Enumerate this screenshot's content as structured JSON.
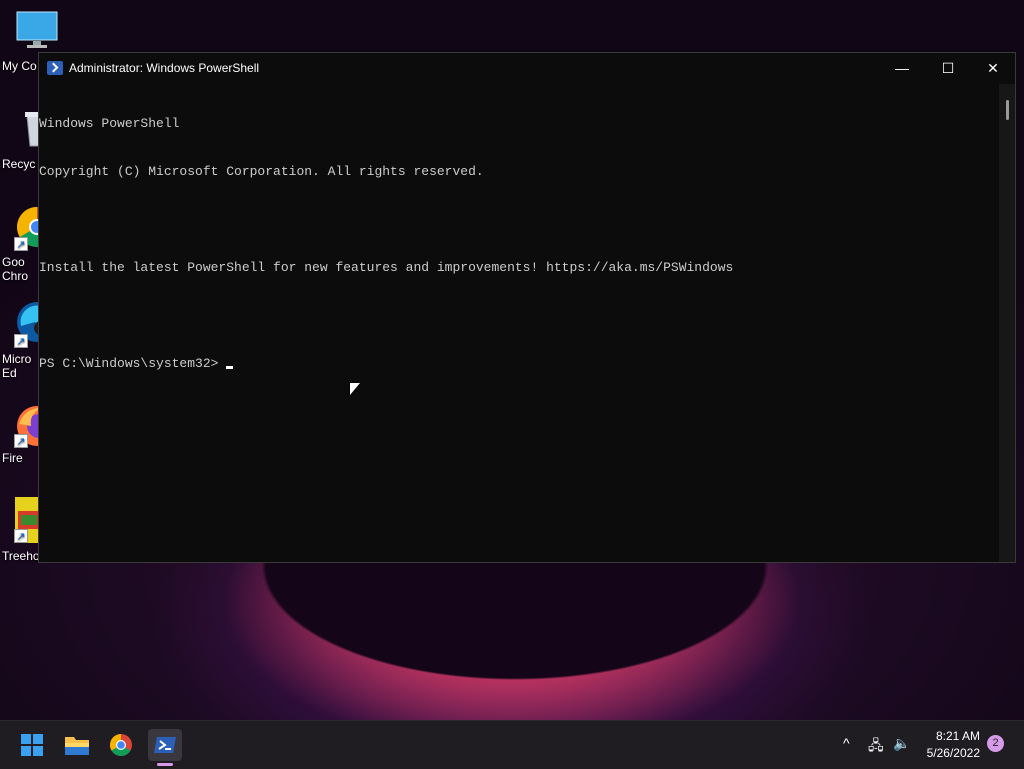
{
  "desktop": {
    "icons": [
      {
        "label": "My Co",
        "icon": "monitor-icon"
      },
      {
        "label": "Recyc",
        "icon": "recycle-bin-icon"
      },
      {
        "label": "Goo\nChro",
        "icon": "chrome-icon"
      },
      {
        "label": "Micro\nEd",
        "icon": "edge-icon"
      },
      {
        "label": "Fire",
        "icon": "firefox-icon"
      },
      {
        "label": "Treeho",
        "icon": "treehouse-icon"
      }
    ]
  },
  "window": {
    "title": "Administrator: Windows PowerShell",
    "controls": {
      "minimize": "—",
      "maximize": "☐",
      "close": "✕"
    },
    "console_lines": [
      "Windows PowerShell",
      "Copyright (C) Microsoft Corporation. All rights reserved.",
      "",
      "Install the latest PowerShell for new features and improvements! https://aka.ms/PSWindows",
      "",
      "PS C:\\Windows\\system32> "
    ]
  },
  "taskbar": {
    "apps": [
      "start-icon",
      "file-explorer-icon",
      "chrome-icon",
      "powershell-icon"
    ],
    "tray": {
      "chevron": "^",
      "network": "🖧",
      "volume": "🔈"
    },
    "clock": {
      "time": "8:21 AM",
      "date": "5/26/2022"
    },
    "notification_count": "2"
  },
  "colors": {
    "console_bg": "#0c0c0c",
    "console_text": "#cccccc",
    "taskbar_bg": "#1f1d22",
    "accent": "#d59be8"
  }
}
